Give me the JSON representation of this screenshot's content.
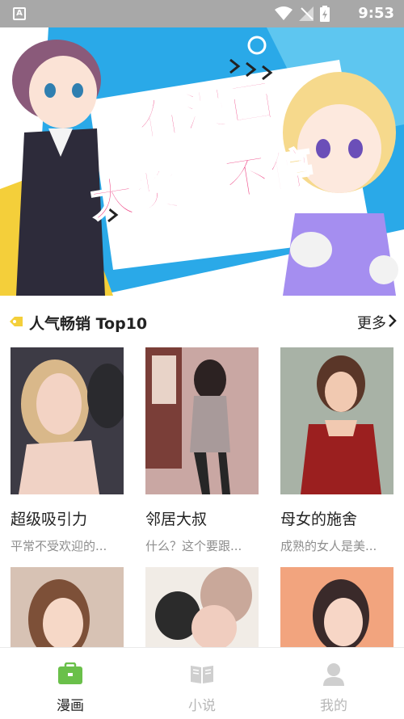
{
  "status_bar": {
    "time": "9:53"
  },
  "banner": {
    "line1": "看漫画",
    "line2": "大奖赚不停",
    "colors": {
      "pink": "#ef4d8a",
      "blue": "#29a8e8",
      "yellow": "#f4cf3a"
    }
  },
  "section": {
    "title": "人气畅销 Top10",
    "more_label": "更多"
  },
  "cards": [
    {
      "title": "超级吸引力",
      "subtitle": "平常不受欢迎的..."
    },
    {
      "title": "邻居大叔",
      "subtitle": "什么？这个要跟..."
    },
    {
      "title": "母女的施舍",
      "subtitle": "成熟的女人是美..."
    },
    {
      "title": "",
      "subtitle": ""
    },
    {
      "title": "",
      "subtitle": ""
    },
    {
      "title": "",
      "subtitle": ""
    }
  ],
  "bottom_nav": [
    {
      "label": "漫画",
      "icon": "manga-icon",
      "active": true
    },
    {
      "label": "小说",
      "icon": "book-icon",
      "active": false
    },
    {
      "label": "我的",
      "icon": "profile-icon",
      "active": false
    }
  ]
}
